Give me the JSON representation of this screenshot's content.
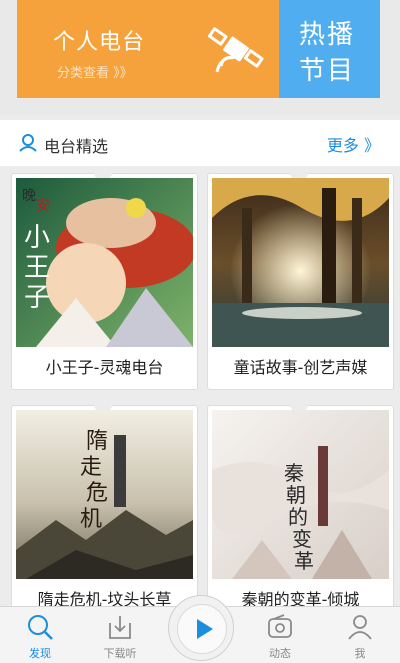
{
  "banner": {
    "personal_title": "个人电台",
    "personal_subtitle": "分类查看 》》",
    "hot_line1": "热播",
    "hot_line2": "节目"
  },
  "section": {
    "title": "电台精选",
    "more": "更多 》"
  },
  "cards": [
    {
      "caption": "小王子-灵魂电台",
      "cover_text": [
        "晚",
        "安",
        "小",
        "王",
        "子"
      ]
    },
    {
      "caption": "童话故事-创艺声媒"
    },
    {
      "caption": "隋走危机-坟头长草",
      "cover_text": [
        "隋",
        "走",
        "危",
        "机"
      ]
    },
    {
      "caption": "秦朝的变革-倾城",
      "cover_text": [
        "秦",
        "朝",
        "的",
        "变",
        "革"
      ]
    }
  ],
  "tabbar": {
    "discover": "发现",
    "downloads": "下载听",
    "activity": "动态",
    "me": "我"
  },
  "colors": {
    "orange": "#f6a23c",
    "blue": "#50aef0",
    "accent": "#1b8ee0"
  }
}
